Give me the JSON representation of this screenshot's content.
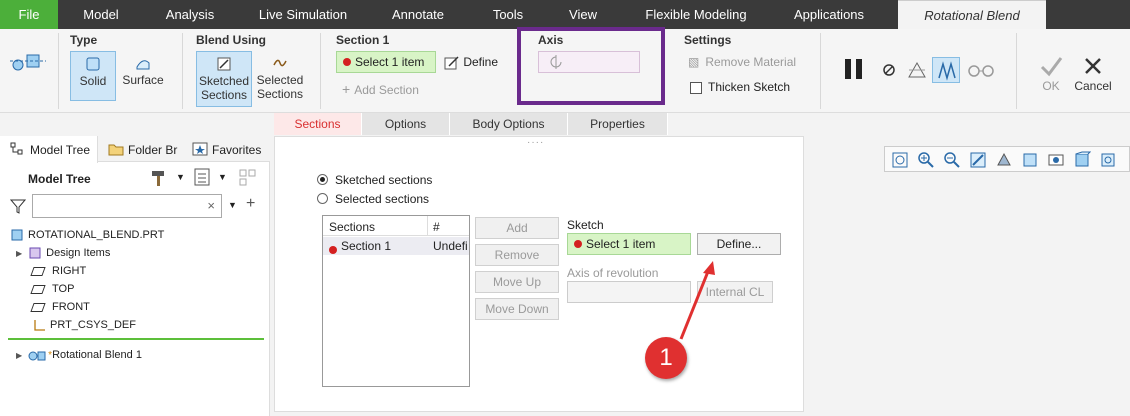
{
  "menu": {
    "file": "File",
    "model": "Model",
    "analysis": "Analysis",
    "live_simulation": "Live Simulation",
    "annotate": "Annotate",
    "tools": "Tools",
    "view": "View",
    "flexible_modeling": "Flexible Modeling",
    "applications": "Applications",
    "rotational_blend": "Rotational Blend"
  },
  "ribbon": {
    "type": {
      "title": "Type",
      "solid": "Solid",
      "surface": "Surface"
    },
    "blend_using": {
      "title": "Blend Using",
      "sketched_line1": "Sketched",
      "sketched_line2": "Sections",
      "selected_line1": "Selected",
      "selected_line2": "Sections"
    },
    "section1": {
      "title": "Section 1",
      "select": "Select 1 item",
      "define": "Define",
      "add_section": "Add Section"
    },
    "axis": {
      "title": "Axis"
    },
    "settings": {
      "title": "Settings",
      "remove_material": "Remove Material",
      "thicken_sketch": "Thicken Sketch"
    },
    "ok": "OK",
    "cancel": "Cancel"
  },
  "subtabs": [
    "Sections",
    "Options",
    "Body Options",
    "Properties"
  ],
  "left": {
    "tabs": {
      "model_tree": "Model Tree",
      "folder_browser": "Folder Br",
      "favorites": "Favorites"
    },
    "header": "Model Tree",
    "items": {
      "root": "ROTATIONAL_BLEND.PRT",
      "design_items": "Design Items",
      "right": "RIGHT",
      "top": "TOP",
      "front": "FRONT",
      "csys": "PRT_CSYS_DEF",
      "feature": "Rotational Blend 1"
    }
  },
  "center": {
    "radio_sketched": "Sketched sections",
    "radio_selected": "Selected sections",
    "table": {
      "col_sections": "Sections",
      "col_num": "#",
      "row1_name": "Section 1",
      "row1_num": "Undefi"
    },
    "buttons": {
      "add": "Add",
      "remove": "Remove",
      "move_up": "Move Up",
      "move_down": "Move Down"
    },
    "sketch_label": "Sketch",
    "sketch_select": "Select 1 item",
    "define": "Define...",
    "axis_label": "Axis of revolution",
    "internal_cl": "Internal CL",
    "callout": "1"
  },
  "colors": {
    "highlight_box": "#6a2a8c",
    "callout": "#e03030"
  }
}
